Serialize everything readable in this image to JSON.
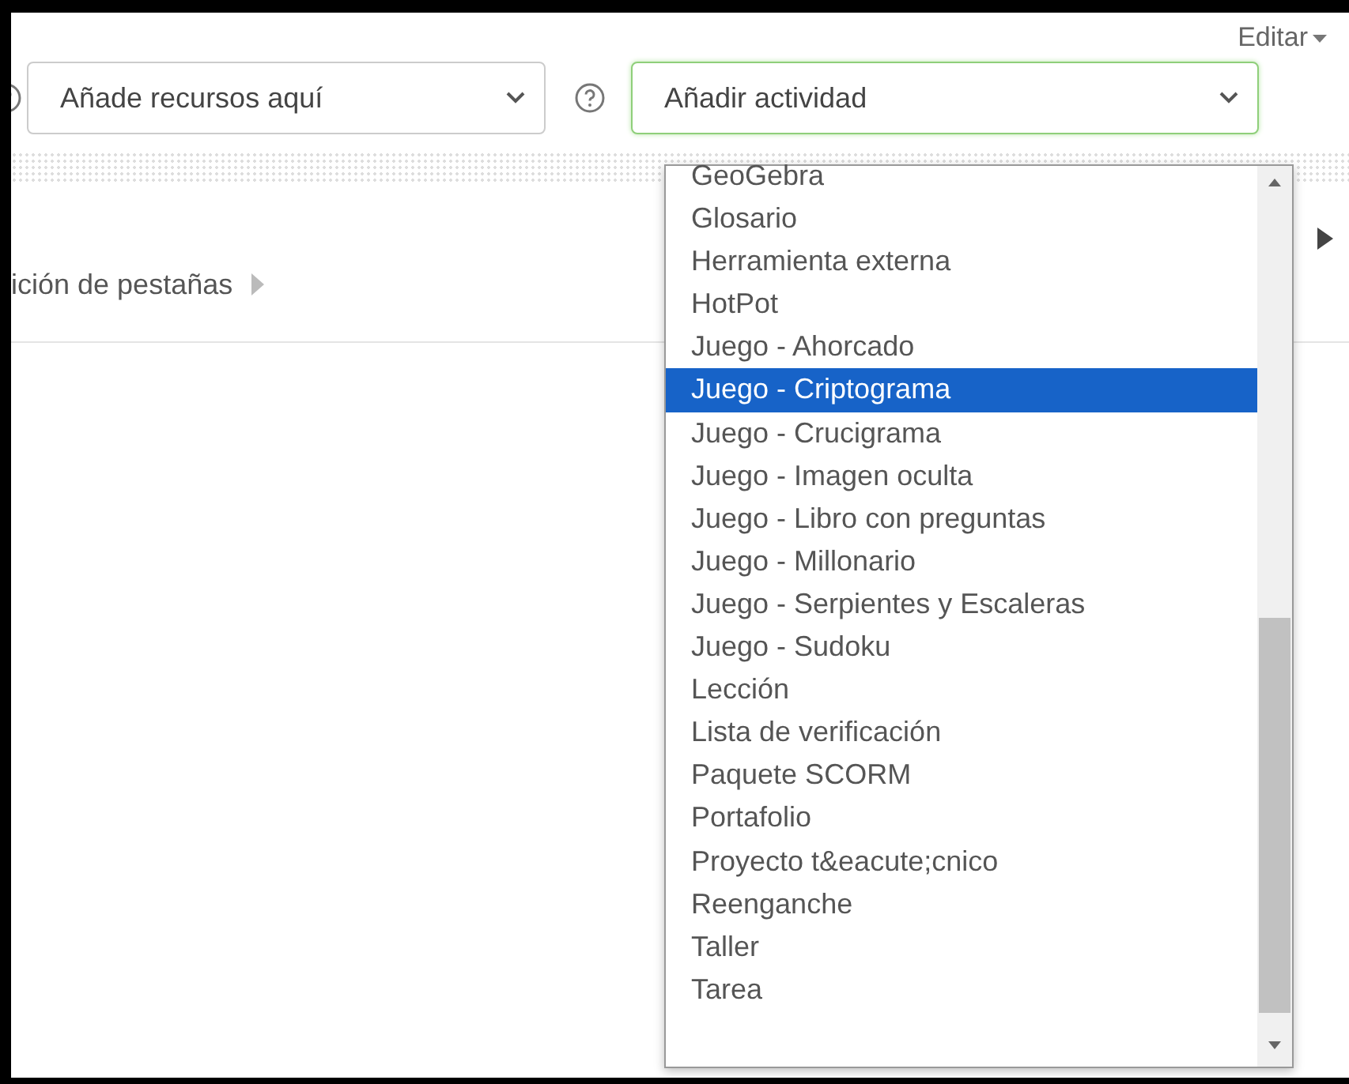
{
  "edit_menu": {
    "label": "Editar"
  },
  "resource_select": {
    "value": "Añade recursos aquí"
  },
  "activity_select": {
    "value": "Añadir actividad",
    "focused": true,
    "options": [
      {
        "label": "GeoGebra",
        "selected": false
      },
      {
        "label": "Glosario",
        "selected": false
      },
      {
        "label": "Herramienta externa",
        "selected": false
      },
      {
        "label": "HotPot",
        "selected": false
      },
      {
        "label": "Juego - Ahorcado",
        "selected": false
      },
      {
        "label": "Juego - Criptograma",
        "selected": true
      },
      {
        "label": "Juego - Crucigrama",
        "selected": false
      },
      {
        "label": "Juego - Imagen oculta",
        "selected": false
      },
      {
        "label": "Juego - Libro con preguntas",
        "selected": false
      },
      {
        "label": "Juego - Millonario",
        "selected": false
      },
      {
        "label": "Juego - Serpientes y Escaleras",
        "selected": false
      },
      {
        "label": "Juego - Sudoku",
        "selected": false
      },
      {
        "label": "Lección",
        "selected": false
      },
      {
        "label": "Lista de verificación",
        "selected": false
      },
      {
        "label": "Paquete SCORM",
        "selected": false
      },
      {
        "label": "Portafolio",
        "selected": false
      },
      {
        "label": "Proyecto t&eacute;cnico",
        "selected": false
      },
      {
        "label": "Reenganche",
        "selected": false
      },
      {
        "label": "Taller",
        "selected": false
      },
      {
        "label": "Tarea",
        "selected": false
      }
    ]
  },
  "section_link": {
    "label": "ición de pestañas"
  }
}
